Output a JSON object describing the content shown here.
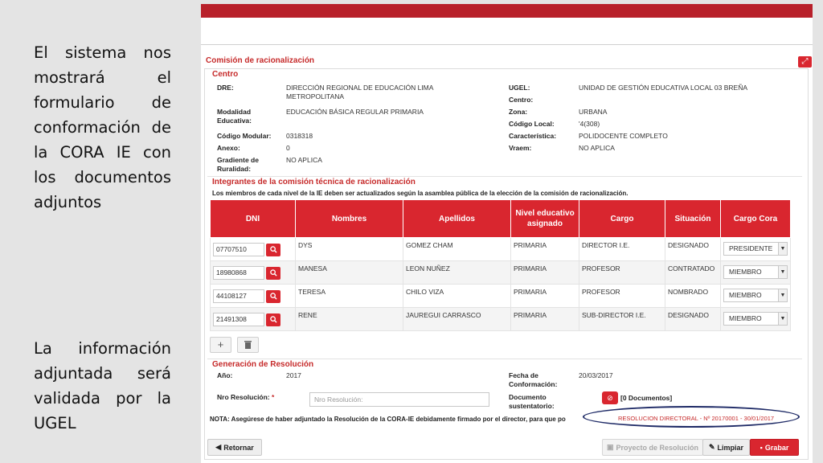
{
  "side_text": {
    "top": "El sistema nos mostrará el formulario de conformación de la CORA IE con los documentos adjuntos",
    "bottom": "La información adjuntada será validada por la UGEL"
  },
  "form": {
    "title": "Comisión de racionalización",
    "centro": {
      "section_title": "Centro",
      "dre_label": "DRE:",
      "dre_value": "DIRECCIÓN REGIONAL DE EDUCACIÓN LIMA METROPOLITANA",
      "modalidad_label": "Modalidad Educativa:",
      "modalidad_value": "EDUCACIÓN BÁSICA REGULAR PRIMARIA",
      "codigo_modular_label": "Código Modular:",
      "codigo_modular_value": "0318318",
      "anexo_label": "Anexo:",
      "anexo_value": "0",
      "gradiente_label": "Gradiente de Ruralidad:",
      "gradiente_value": "NO APLICA",
      "ugel_label": "UGEL:",
      "ugel_value": "UNIDAD DE GESTIÓN EDUCATIVA LOCAL 03 BREÑA",
      "centro_label": "Centro:",
      "centro_value": "",
      "zona_label": "Zona:",
      "zona_value": "URBANA",
      "codigo_local_label": "Código Local:",
      "codigo_local_value": "'4(308)",
      "caracteristica_label": "Característica:",
      "caracteristica_value": "POLIDOCENTE COMPLETO",
      "vraem_label": "Vraem:",
      "vraem_value": "NO APLICA"
    },
    "integrantes": {
      "section_title": "Integrantes de la comisión técnica de racionalización",
      "note": "Los miembros de cada nivel de la IE deben ser actualizados según la asamblea pública de la elección de la comisión de racionalización.",
      "columns": [
        "DNI",
        "Nombres",
        "Apellidos",
        "Nivel educativo asignado",
        "Cargo",
        "Situación",
        "Cargo Cora"
      ],
      "rows": [
        {
          "dni": "07707510",
          "nombres": "DYS",
          "apellidos": "GOMEZ CHAM",
          "nivel": "PRIMARIA",
          "cargo": "DIRECTOR I.E.",
          "situacion": "DESIGNADO",
          "cargo_cora": "PRESIDENTE"
        },
        {
          "dni": "18980868",
          "nombres": "MANESA",
          "apellidos": "LEON NUÑEZ",
          "nivel": "PRIMARIA",
          "cargo": "PROFESOR",
          "situacion": "CONTRATADO",
          "cargo_cora": "MIEMBRO"
        },
        {
          "dni": "44108127",
          "nombres": "TERESA",
          "apellidos": "CHILO VIZA",
          "nivel": "PRIMARIA",
          "cargo": "PROFESOR",
          "situacion": "NOMBRADO",
          "cargo_cora": "MIEMBRO"
        },
        {
          "dni": "21491308",
          "nombres": "RENE",
          "apellidos": "JAUREGUI CARRASCO",
          "nivel": "PRIMARIA",
          "cargo": "SUB-DIRECTOR I.E.",
          "situacion": "DESIGNADO",
          "cargo_cora": "MIEMBRO"
        }
      ]
    },
    "resolucion": {
      "section_title": "Generación de Resolución",
      "anio_label": "Año:",
      "anio_value": "2017",
      "fecha_label": "Fecha de Conformación:",
      "fecha_value": "20/03/2017",
      "nro_label": "Nro Resolución:",
      "required_mark": "*",
      "nro_placeholder": "Nro Resolución:",
      "doc_label": "Documento sustentatorio:",
      "doc_count": "[0 Documentos]",
      "doc_link": "RESOLUCION DIRECTORAL - Nº 20170001 - 30/01/2017",
      "nota": "NOTA: Asegúrese de haber adjuntado la Resolución de la CORA-IE debidamente firmado por el director, para que po"
    },
    "buttons": {
      "retornar": "Retornar",
      "proyecto": "Proyecto de Resolución",
      "limpiar": "Limpiar",
      "grabar": "Grabar"
    }
  },
  "colors": {
    "brand_red": "#d9262f",
    "topbar_red": "#b8202a",
    "highlight_ellipse": "#1e2a66"
  }
}
